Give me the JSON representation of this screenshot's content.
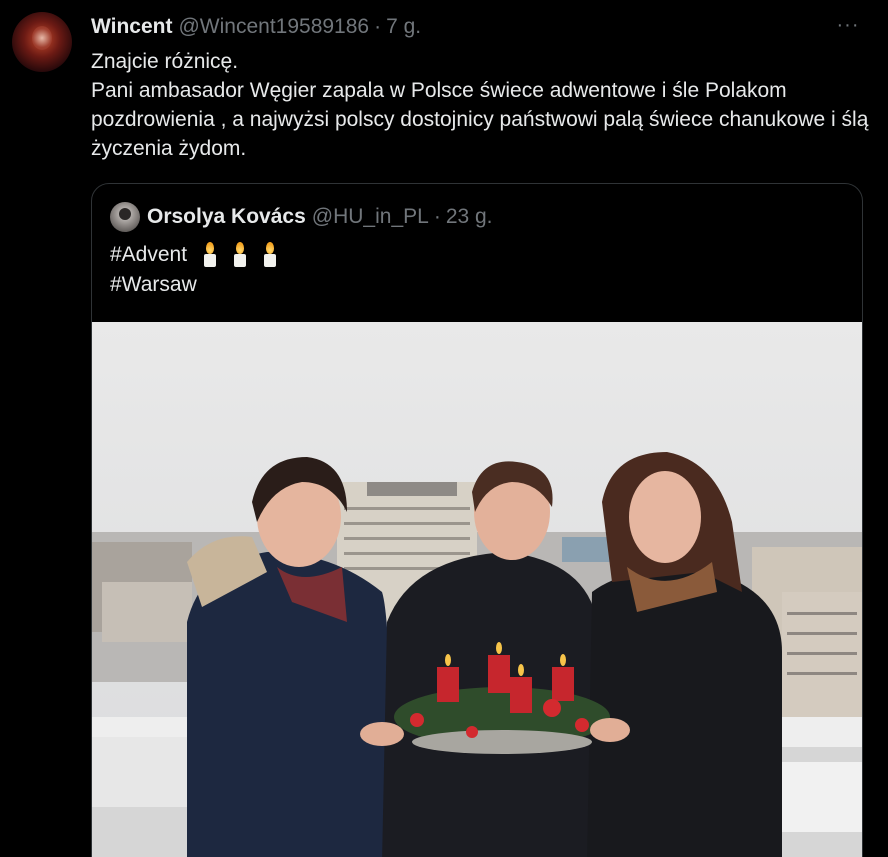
{
  "tweet": {
    "author_name": "Wincent",
    "author_handle": "@Wincent19589186",
    "separator": "·",
    "time": "7 g.",
    "more_glyph": "···",
    "text": "Znajcie różnicę.\nPani ambasador Węgier zapala w Polsce świece adwentowe i śle Polakom pozdrowienia , a najwyżsi polscy dostojnicy państwowi palą świece chanukowe i  ślą życzenia żydom."
  },
  "quote": {
    "author_name": "Orsolya Kovács",
    "author_handle": "@HU_in_PL",
    "separator": "·",
    "time": "23 g.",
    "line1": "#Advent",
    "line2": "#Warsaw",
    "candle_emoji_count": 3
  },
  "colors": {
    "background": "#000000",
    "text": "#e7e9ea",
    "muted": "#71767b",
    "border": "#2f3336"
  },
  "icons": [
    "more-icon",
    "candle-icon"
  ]
}
